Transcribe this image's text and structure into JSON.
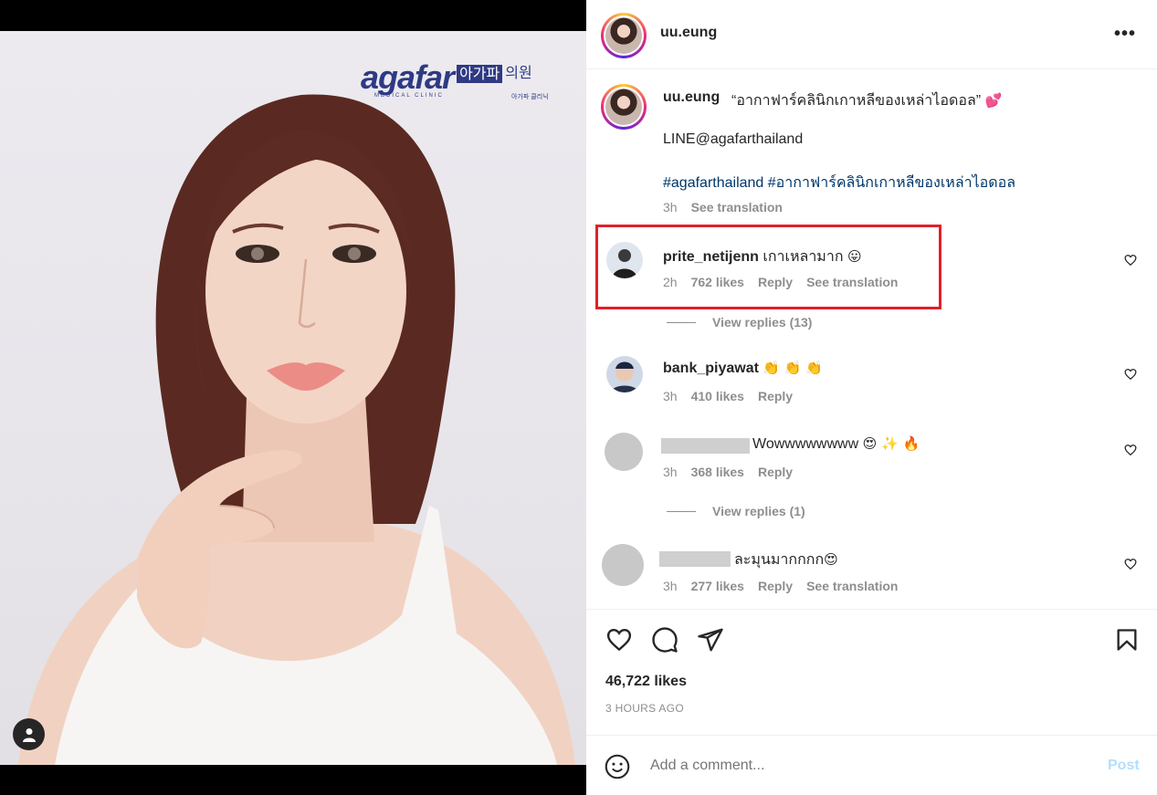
{
  "post": {
    "logo": {
      "word": "agafar",
      "ko_boxed": "아가파",
      "ko": "의원",
      "sub": "MEDICAL CLINIC",
      "sub_ko": "아가파 클리닉"
    },
    "author": "uu.eung",
    "more_label": "•••",
    "caption": {
      "username": "uu.eung",
      "text": "“อากาฟาร์คลินิกเกาหลีของเหล่าไอดอล”",
      "emoji": "💕",
      "line2": "LINE@agafarthailand",
      "tags": "#agafarthailand #อากาฟาร์คลินิกเกาหลีของเหล่าไอดอล",
      "time": "3h",
      "see_translation": "See translation"
    },
    "comments": [
      {
        "username": "prite_netijenn",
        "text": "เกาเหลามาก",
        "emoji": "😛",
        "time": "2h",
        "likes": "762 likes",
        "reply": "Reply",
        "see_translation": "See translation",
        "view_replies": "View replies (13)"
      },
      {
        "username": "bank_piyawat",
        "text": "",
        "emoji": "👏 👏 👏",
        "time": "3h",
        "likes": "410 likes",
        "reply": "Reply"
      },
      {
        "username": "",
        "text": "Wowwwwwwww",
        "emoji": "😍 ✨ 🔥",
        "time": "3h",
        "likes": "368 likes",
        "reply": "Reply",
        "view_replies": "View replies (1)"
      },
      {
        "username": "",
        "text": "ละมุนมากกกก",
        "emoji": "😍",
        "time": "3h",
        "likes": "277 likes",
        "reply": "Reply",
        "see_translation": "See translation"
      }
    ],
    "likes_total": "46,722 likes",
    "posted_ago": "3 HOURS AGO",
    "add_comment_placeholder": "Add a comment...",
    "post_label": "Post"
  },
  "colors": {
    "highlight": "#e0202a",
    "link": "#00376b",
    "muted": "#8e8e8e",
    "post_disabled": "#b2dffc"
  }
}
